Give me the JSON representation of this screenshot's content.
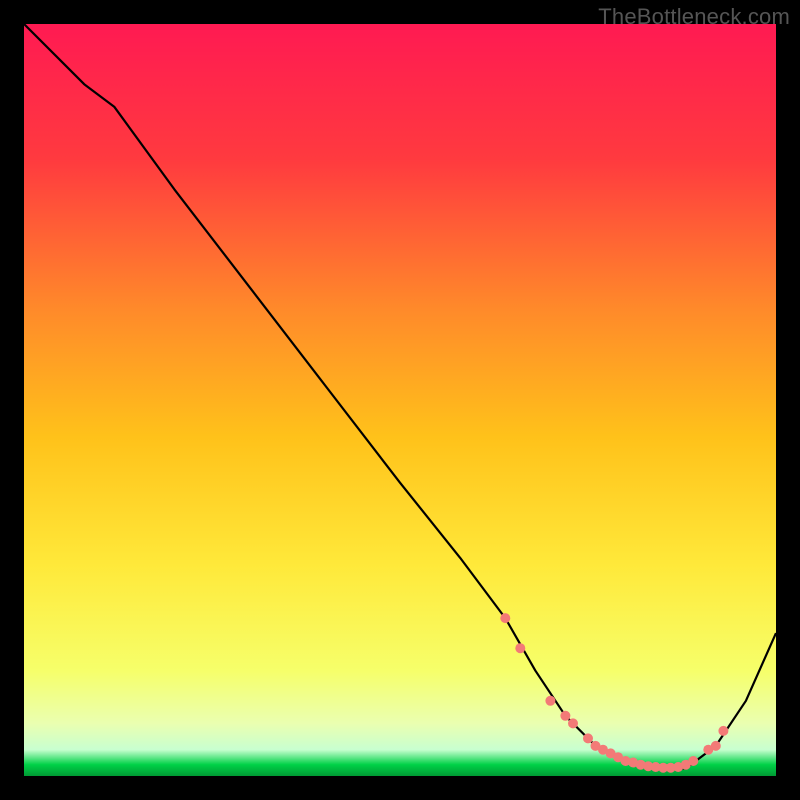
{
  "watermark": "TheBottleneck.com",
  "colors": {
    "top": "#ff1a52",
    "mid_upper": "#ff7a2e",
    "mid": "#ffd400",
    "mid_lower": "#f6ff6a",
    "pale": "#f3ffc2",
    "green": "#00d147",
    "black": "#000000",
    "line": "#000000",
    "dot": "#f37a77"
  },
  "chart_data": {
    "type": "line",
    "title": "",
    "xlabel": "",
    "ylabel": "",
    "xlim": [
      0,
      100
    ],
    "ylim": [
      0,
      100
    ],
    "grid": false,
    "series": [
      {
        "name": "curve",
        "x": [
          0,
          8,
          12,
          20,
          30,
          40,
          50,
          58,
          64,
          68,
          72,
          76,
          80,
          84,
          88,
          92,
          96,
          100
        ],
        "y": [
          100,
          92,
          89,
          78,
          65,
          52,
          39,
          29,
          21,
          14,
          8,
          4,
          2,
          1,
          1,
          4,
          10,
          19
        ]
      }
    ],
    "dots": {
      "x": [
        64,
        66,
        70,
        72,
        73,
        75,
        76,
        77,
        78,
        79,
        80,
        81,
        82,
        83,
        84,
        85,
        86,
        87,
        88,
        89,
        91,
        92,
        93
      ],
      "y": [
        21,
        17,
        10,
        8,
        7,
        5,
        4,
        3.5,
        3,
        2.5,
        2,
        1.8,
        1.5,
        1.3,
        1.2,
        1.1,
        1.1,
        1.2,
        1.5,
        2,
        3.5,
        4,
        6
      ]
    }
  }
}
